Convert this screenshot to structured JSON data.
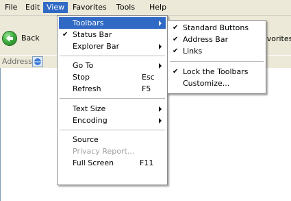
{
  "menubar": {
    "items": [
      {
        "label": "File"
      },
      {
        "label": "Edit"
      },
      {
        "label": "View"
      },
      {
        "label": "Favorites"
      },
      {
        "label": "Tools"
      },
      {
        "label": "Help"
      }
    ]
  },
  "toolbar": {
    "back_label": "Back",
    "favorites_partial": "avorites"
  },
  "addressbar": {
    "label": "Address"
  },
  "view_menu": {
    "items": [
      {
        "label": "Toolbars",
        "checked": false,
        "submenu": true
      },
      {
        "label": "Status Bar",
        "checked": true,
        "check_glyph": "✔"
      },
      {
        "label": "Explorer Bar",
        "submenu": true
      },
      {
        "label": "Go To",
        "submenu": true
      },
      {
        "label": "Stop",
        "shortcut": "Esc"
      },
      {
        "label": "Refresh",
        "shortcut": "F5"
      },
      {
        "label": "Text Size",
        "submenu": true
      },
      {
        "label": "Encoding",
        "submenu": true
      },
      {
        "label": "Source"
      },
      {
        "label": "Privacy Report...",
        "disabled": true
      },
      {
        "label": "Full Screen",
        "shortcut": "F11"
      }
    ]
  },
  "toolbars_submenu": {
    "items": [
      {
        "label": "Standard Buttons",
        "checked": true,
        "check_glyph": "✔"
      },
      {
        "label": "Address Bar",
        "checked": true,
        "check_glyph": "✔"
      },
      {
        "label": "Links",
        "checked": true,
        "check_glyph": "✔"
      },
      {
        "label": "Lock the Toolbars",
        "checked": true,
        "check_glyph": "✔"
      },
      {
        "label": "Customize..."
      }
    ]
  },
  "colors": {
    "chrome": "#ece9d8",
    "highlight": "#316ac5",
    "disabled_text": "#a0a0a0"
  }
}
